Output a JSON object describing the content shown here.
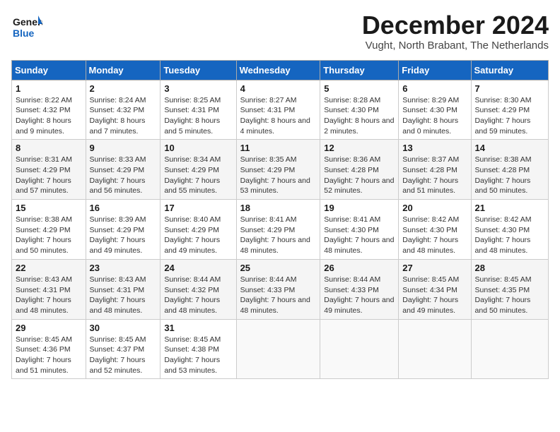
{
  "header": {
    "logo_line1": "General",
    "logo_line2": "Blue",
    "month_title": "December 2024",
    "location": "Vught, North Brabant, The Netherlands"
  },
  "weekdays": [
    "Sunday",
    "Monday",
    "Tuesday",
    "Wednesday",
    "Thursday",
    "Friday",
    "Saturday"
  ],
  "weeks": [
    [
      {
        "day": "1",
        "sunrise": "8:22 AM",
        "sunset": "4:32 PM",
        "daylight": "8 hours and 9 minutes."
      },
      {
        "day": "2",
        "sunrise": "8:24 AM",
        "sunset": "4:32 PM",
        "daylight": "8 hours and 7 minutes."
      },
      {
        "day": "3",
        "sunrise": "8:25 AM",
        "sunset": "4:31 PM",
        "daylight": "8 hours and 5 minutes."
      },
      {
        "day": "4",
        "sunrise": "8:27 AM",
        "sunset": "4:31 PM",
        "daylight": "8 hours and 4 minutes."
      },
      {
        "day": "5",
        "sunrise": "8:28 AM",
        "sunset": "4:30 PM",
        "daylight": "8 hours and 2 minutes."
      },
      {
        "day": "6",
        "sunrise": "8:29 AM",
        "sunset": "4:30 PM",
        "daylight": "8 hours and 0 minutes."
      },
      {
        "day": "7",
        "sunrise": "8:30 AM",
        "sunset": "4:29 PM",
        "daylight": "7 hours and 59 minutes."
      }
    ],
    [
      {
        "day": "8",
        "sunrise": "8:31 AM",
        "sunset": "4:29 PM",
        "daylight": "7 hours and 57 minutes."
      },
      {
        "day": "9",
        "sunrise": "8:33 AM",
        "sunset": "4:29 PM",
        "daylight": "7 hours and 56 minutes."
      },
      {
        "day": "10",
        "sunrise": "8:34 AM",
        "sunset": "4:29 PM",
        "daylight": "7 hours and 55 minutes."
      },
      {
        "day": "11",
        "sunrise": "8:35 AM",
        "sunset": "4:29 PM",
        "daylight": "7 hours and 53 minutes."
      },
      {
        "day": "12",
        "sunrise": "8:36 AM",
        "sunset": "4:28 PM",
        "daylight": "7 hours and 52 minutes."
      },
      {
        "day": "13",
        "sunrise": "8:37 AM",
        "sunset": "4:28 PM",
        "daylight": "7 hours and 51 minutes."
      },
      {
        "day": "14",
        "sunrise": "8:38 AM",
        "sunset": "4:28 PM",
        "daylight": "7 hours and 50 minutes."
      }
    ],
    [
      {
        "day": "15",
        "sunrise": "8:38 AM",
        "sunset": "4:29 PM",
        "daylight": "7 hours and 50 minutes."
      },
      {
        "day": "16",
        "sunrise": "8:39 AM",
        "sunset": "4:29 PM",
        "daylight": "7 hours and 49 minutes."
      },
      {
        "day": "17",
        "sunrise": "8:40 AM",
        "sunset": "4:29 PM",
        "daylight": "7 hours and 49 minutes."
      },
      {
        "day": "18",
        "sunrise": "8:41 AM",
        "sunset": "4:29 PM",
        "daylight": "7 hours and 48 minutes."
      },
      {
        "day": "19",
        "sunrise": "8:41 AM",
        "sunset": "4:30 PM",
        "daylight": "7 hours and 48 minutes."
      },
      {
        "day": "20",
        "sunrise": "8:42 AM",
        "sunset": "4:30 PM",
        "daylight": "7 hours and 48 minutes."
      },
      {
        "day": "21",
        "sunrise": "8:42 AM",
        "sunset": "4:30 PM",
        "daylight": "7 hours and 48 minutes."
      }
    ],
    [
      {
        "day": "22",
        "sunrise": "8:43 AM",
        "sunset": "4:31 PM",
        "daylight": "7 hours and 48 minutes."
      },
      {
        "day": "23",
        "sunrise": "8:43 AM",
        "sunset": "4:31 PM",
        "daylight": "7 hours and 48 minutes."
      },
      {
        "day": "24",
        "sunrise": "8:44 AM",
        "sunset": "4:32 PM",
        "daylight": "7 hours and 48 minutes."
      },
      {
        "day": "25",
        "sunrise": "8:44 AM",
        "sunset": "4:33 PM",
        "daylight": "7 hours and 48 minutes."
      },
      {
        "day": "26",
        "sunrise": "8:44 AM",
        "sunset": "4:33 PM",
        "daylight": "7 hours and 49 minutes."
      },
      {
        "day": "27",
        "sunrise": "8:45 AM",
        "sunset": "4:34 PM",
        "daylight": "7 hours and 49 minutes."
      },
      {
        "day": "28",
        "sunrise": "8:45 AM",
        "sunset": "4:35 PM",
        "daylight": "7 hours and 50 minutes."
      }
    ],
    [
      {
        "day": "29",
        "sunrise": "8:45 AM",
        "sunset": "4:36 PM",
        "daylight": "7 hours and 51 minutes."
      },
      {
        "day": "30",
        "sunrise": "8:45 AM",
        "sunset": "4:37 PM",
        "daylight": "7 hours and 52 minutes."
      },
      {
        "day": "31",
        "sunrise": "8:45 AM",
        "sunset": "4:38 PM",
        "daylight": "7 hours and 53 minutes."
      },
      null,
      null,
      null,
      null
    ]
  ]
}
